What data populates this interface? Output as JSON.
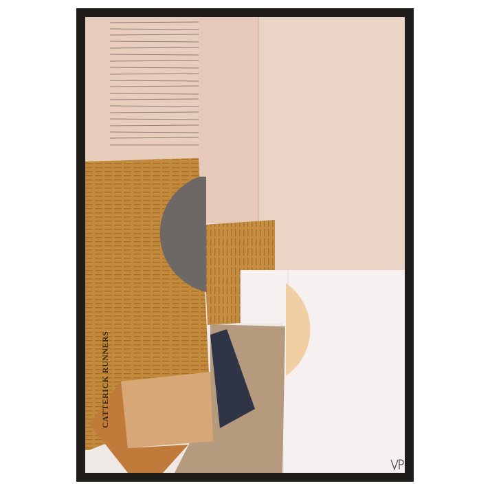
{
  "artwork": {
    "kind": "framed abstract paper collage",
    "frame_color": "#1f1c1a",
    "colors": {
      "blush_paper": "#e8cdbd",
      "blush_paper_right": "#ebd3c5",
      "newsprint": "#c48a3c",
      "grey_half_circle": "#6d6866",
      "white_paper": "#f6f0f0",
      "cream_half_circle": "#f0cfa5",
      "navy_shard": "#2f3446",
      "tan_card": "#b59a7e",
      "sand_card": "#d8a778",
      "rust_card": "#c07a3a"
    },
    "headline": "CATTERICK RUNNERS",
    "signature": "VP"
  }
}
